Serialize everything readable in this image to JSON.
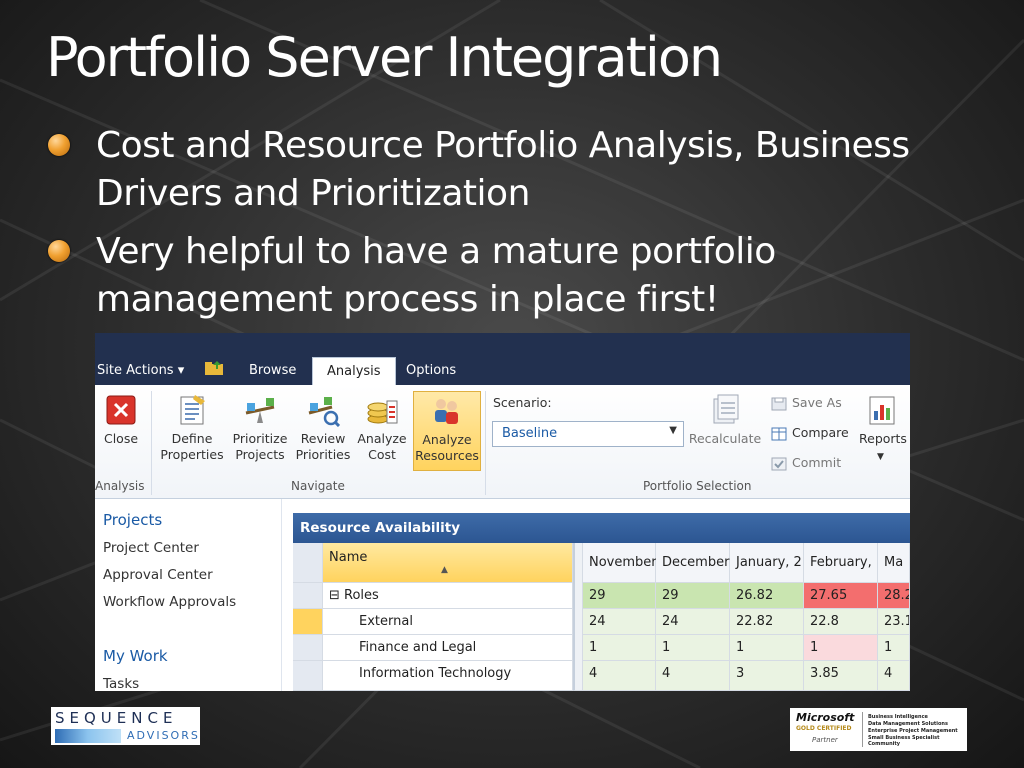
{
  "slide": {
    "title": "Portfolio Server Integration",
    "bullets": [
      "Cost and Resource Portfolio Analysis, Business Drivers and Prioritization",
      "Very helpful to have a mature portfolio management process in place first!"
    ]
  },
  "topbar": {
    "site_actions": "Site Actions ▾",
    "tabs": [
      "Browse",
      "Analysis",
      "Options"
    ],
    "active_tab": "Analysis"
  },
  "ribbon": {
    "buttons": {
      "close": "Close",
      "define": "Define Properties",
      "prioritize": "Prioritize Projects",
      "review": "Review Priorities",
      "analyze_cost": "Analyze Cost",
      "analyze_resources": "Analyze Resources",
      "recalculate": "Recalculate",
      "save_as": "Save As",
      "compare": "Compare",
      "commit": "Commit",
      "reports": "Reports"
    },
    "groups": {
      "analysis": "Analysis",
      "navigate": "Navigate",
      "portfolio_selection": "Portfolio Selection"
    },
    "scenario_label": "Scenario:",
    "scenario_value": "Baseline"
  },
  "leftnav": {
    "projects_header": "Projects",
    "project_items": [
      "Project Center",
      "Approval Center",
      "Workflow Approvals"
    ],
    "mywork_header": "My Work",
    "mywork_items": [
      "Tasks"
    ]
  },
  "grid": {
    "title": "Resource Availability",
    "name_header": "Name",
    "months": [
      "November",
      "December",
      "January, 2",
      "February,",
      "Ma"
    ],
    "rows": [
      {
        "name": "⊟ Roles",
        "values": [
          "29",
          "29",
          "26.82",
          "27.65",
          "28.2"
        ]
      },
      {
        "name": "External",
        "values": [
          "24",
          "24",
          "22.82",
          "22.8",
          "23.1"
        ]
      },
      {
        "name": "Finance and Legal",
        "values": [
          "1",
          "1",
          "1",
          "1",
          "1"
        ]
      },
      {
        "name": "Information Technology",
        "values": [
          "4",
          "4",
          "3",
          "3.85",
          "4"
        ]
      }
    ]
  },
  "logos": {
    "sequence_top": "SEQUENCE",
    "sequence_bottom": "ADVISORS",
    "ms_name": "Microsoft",
    "ms_gold": "GOLD CERTIFIED",
    "ms_partner": "Partner",
    "ms_lines": [
      "Business Intelligence",
      "Data Management Solutions",
      "Enterprise Project Management",
      "Small Business Specialist Community"
    ]
  }
}
